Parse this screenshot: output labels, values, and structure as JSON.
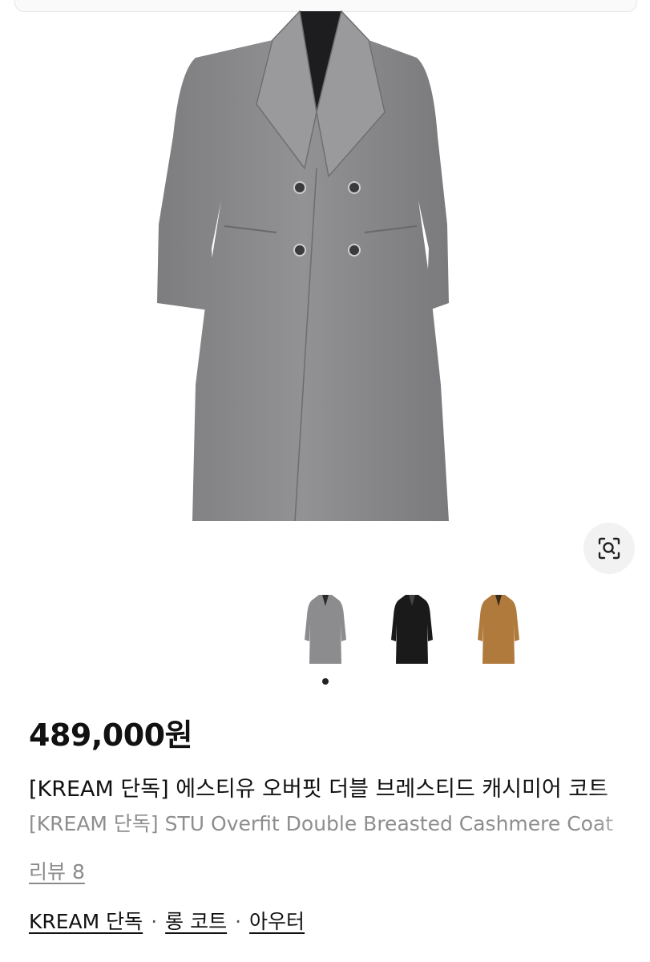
{
  "product": {
    "price": "489,000원",
    "title_ko": "[KREAM 단독] 에스티유 오버핏 더블 브레스티드 캐시미어 코트",
    "title_en": "[KREAM 단독] STU Overfit Double Breasted Cashmere Coat"
  },
  "gallery": {
    "main_color": "#8c8c8f",
    "lens_icon": "image-search-icon",
    "variants": [
      {
        "name": "grey",
        "color": "#8c8c8f"
      },
      {
        "name": "black",
        "color": "#1a1a1a"
      },
      {
        "name": "camel",
        "color": "#b07a3c"
      }
    ],
    "pagination": {
      "total": 1,
      "active": 0
    }
  },
  "reviews": {
    "label": "리뷰 8"
  },
  "breadcrumb": {
    "items": [
      "KREAM 단독",
      "롱 코트",
      "아우터"
    ],
    "separator": "·"
  }
}
